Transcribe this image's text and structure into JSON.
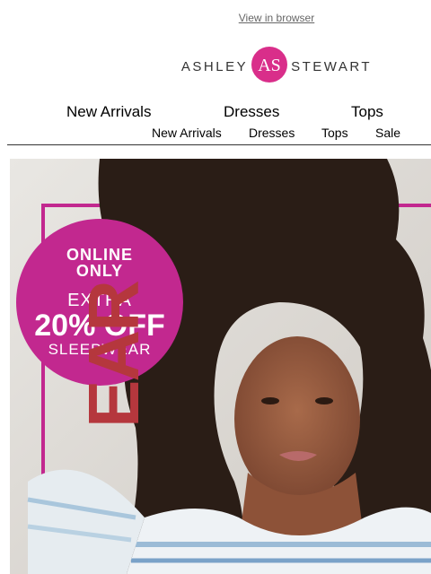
{
  "header": {
    "view_in_browser": "View in browser",
    "brand": {
      "left": "ASHLEY",
      "right": "STEWART",
      "mark": "AS"
    }
  },
  "nav_primary": [
    "New Arrivals",
    "Dresses",
    "Tops"
  ],
  "nav_secondary": [
    "New Arrivals",
    "Dresses",
    "Tops",
    "Sale"
  ],
  "hero": {
    "badge": {
      "line1": "ONLINE",
      "line1b": "ONLY",
      "line2": "EXTRA",
      "line3": "20% OFF",
      "line4": "SLEEPWEAR"
    },
    "side_text": "EAR",
    "colors": {
      "badge": "#c2288f",
      "frame": "#c2288f",
      "side_text": "#b5373d"
    }
  }
}
